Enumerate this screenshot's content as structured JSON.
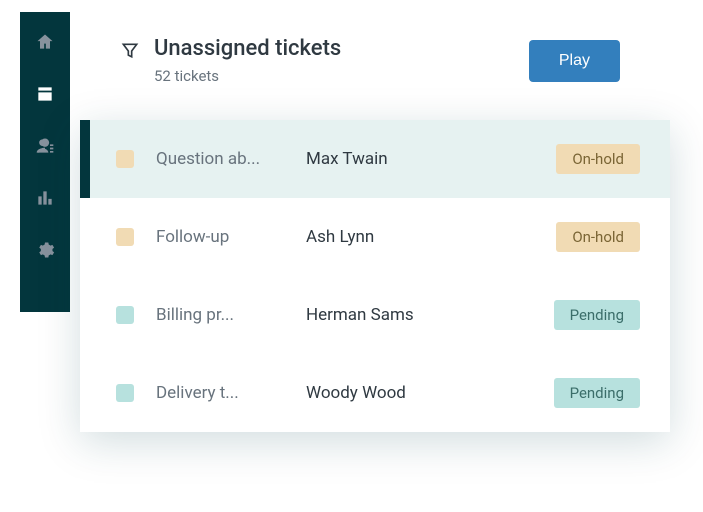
{
  "sidebar": {
    "items": [
      "home-icon",
      "inbox-icon",
      "user-icon",
      "chart-icon",
      "gear-icon"
    ],
    "active_index": 1
  },
  "header": {
    "title": "Unassigned tickets",
    "count_text": "52 tickets",
    "play_label": "Play"
  },
  "tickets": [
    {
      "title": "Question ab...",
      "requester": "Max Twain",
      "status": "On-hold",
      "status_kind": "hold",
      "selected": true
    },
    {
      "title": "Follow-up",
      "requester": "Ash Lynn",
      "status": "On-hold",
      "status_kind": "hold",
      "selected": false
    },
    {
      "title": "Billing pr...",
      "requester": "Herman Sams",
      "status": "Pending",
      "status_kind": "pending",
      "selected": false
    },
    {
      "title": "Delivery t...",
      "requester": "Woody Wood",
      "status": "Pending",
      "status_kind": "pending",
      "selected": false
    }
  ]
}
